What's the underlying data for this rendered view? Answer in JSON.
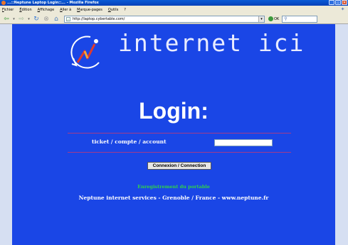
{
  "window": {
    "title": "...::Neptune Laptop Login::... - Mozilla Firefox",
    "buttons": {
      "minimize": "_",
      "maximize": "▫",
      "close": "✕"
    }
  },
  "menu": [
    "Fichier",
    "Édition",
    "Affichage",
    "Aller à",
    "Marque-pages",
    "Outils",
    "?"
  ],
  "nav": {
    "url": "http://laptop.cybertable.com/",
    "go_label": "OK",
    "search_icon": "magnifier-icon",
    "icons": [
      "back-arrow-icon",
      "forward-arrow-icon",
      "reload-icon",
      "stop-icon",
      "home-icon"
    ]
  },
  "page": {
    "background": "#1a46e6",
    "brand": "internet ici",
    "title": "Login:",
    "field_label": "ticket / compte / account",
    "field_value": "",
    "submit_label": "Connexion / Connection",
    "register_link": "Enregistrement du portable",
    "footer": "Neptune internet services - Grenoble / France - www.neptune.fr"
  }
}
